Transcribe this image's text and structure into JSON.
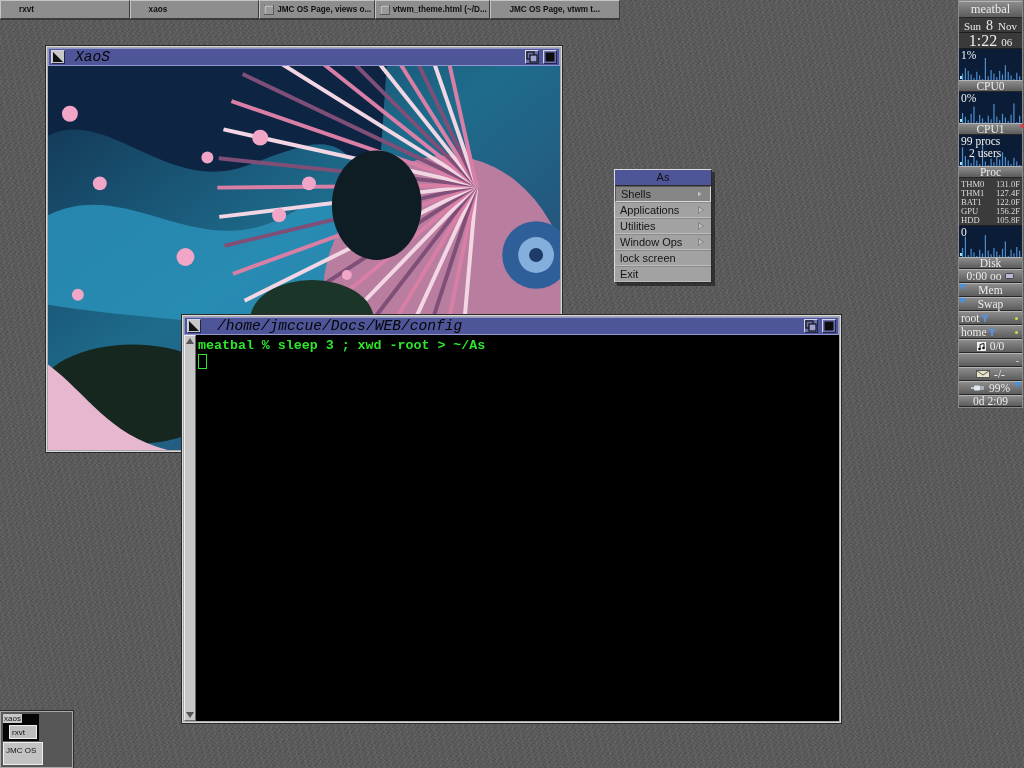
{
  "taskbar": {
    "buttons": [
      {
        "label": "rxvt",
        "kind": "plain"
      },
      {
        "label": "xaos",
        "kind": "plain"
      },
      {
        "label": "JMC OS Page, views o...",
        "kind": "boxed"
      },
      {
        "label": "vtwm_theme.html (~/D...",
        "kind": "boxed"
      },
      {
        "label": "JMC OS Page, vtwm t...",
        "kind": "plain"
      }
    ]
  },
  "windows": [
    {
      "kind": "image",
      "title": "XaoS"
    },
    {
      "kind": "terminal",
      "title": "/home/jmccue/Docs/WEB/config",
      "lines": [
        "meatbal % sleep 3 ; xwd -root > ~/As"
      ],
      "cursor": true
    }
  ],
  "menu": {
    "title": "As",
    "items": [
      {
        "label": "Shells",
        "submenu": true,
        "selected": true
      },
      {
        "label": "Applications",
        "submenu": true,
        "selected": false
      },
      {
        "label": "Utilities",
        "submenu": true,
        "selected": false
      },
      {
        "label": "Window Ops",
        "submenu": true,
        "selected": false
      },
      {
        "label": "lock screen",
        "submenu": false,
        "selected": false
      },
      {
        "label": "Exit",
        "submenu": false,
        "selected": false
      }
    ]
  },
  "monitor_panel": {
    "rows": [
      {
        "kind": "title",
        "text": "meatbal"
      },
      {
        "kind": "date",
        "weekday": "Sun",
        "day": "8",
        "month": "Nov"
      },
      {
        "kind": "clock",
        "time": "1:22",
        "seconds": "06"
      },
      {
        "kind": "graph",
        "lines": [
          "1%"
        ]
      },
      {
        "kind": "label",
        "text": "CPU0",
        "alert": false
      },
      {
        "kind": "graph",
        "lines": [
          "0%"
        ]
      },
      {
        "kind": "label",
        "text": "CPU1",
        "alert": true
      },
      {
        "kind": "graph",
        "lines": [
          "99 procs",
          "2 users"
        ]
      },
      {
        "kind": "label",
        "text": "Proc",
        "alert": false
      },
      {
        "kind": "sensors",
        "items": [
          {
            "name": "THM0",
            "value": "131.0F"
          },
          {
            "name": "THM1",
            "value": "127.4F"
          },
          {
            "name": "BAT1",
            "value": "122.0F"
          },
          {
            "name": "GPU",
            "value": "156.2F"
          },
          {
            "name": "HDD",
            "value": "105.8F"
          }
        ]
      },
      {
        "kind": "graph",
        "lines": [
          "0"
        ]
      },
      {
        "kind": "label",
        "text": "Disk",
        "alert": false
      },
      {
        "kind": "timer",
        "text": "0:00 oo"
      },
      {
        "kind": "meter",
        "text": "Mem",
        "level": 0
      },
      {
        "kind": "meter",
        "text": "Swap",
        "level": 0
      },
      {
        "kind": "mount",
        "text": "root"
      },
      {
        "kind": "mount",
        "text": "home"
      },
      {
        "kind": "counter",
        "text": "0/0"
      },
      {
        "kind": "blank",
        "text": "-"
      },
      {
        "kind": "mail",
        "text": "-/-"
      },
      {
        "kind": "battery",
        "text": "99%",
        "level": 0.99
      },
      {
        "kind": "label",
        "text": "0d 2:09",
        "alert": false
      }
    ]
  },
  "pager": {
    "windows": [
      {
        "kind": "image",
        "label": "xaos"
      },
      {
        "kind": "terminal",
        "label": "rxvt"
      },
      {
        "kind": "browser",
        "label": "JMC OS"
      }
    ]
  }
}
